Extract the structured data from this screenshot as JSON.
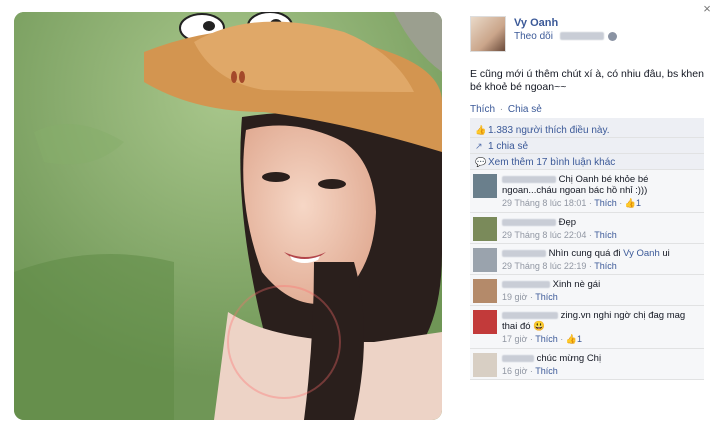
{
  "post": {
    "author_name": "Vy Oanh",
    "follow_label": "Theo dõi",
    "caption": "E cũng mới ú thêm chút xí à, có nhiu đâu, bs khen bé khoẻ bé ngoan~~",
    "actions": {
      "like": "Thích",
      "sep": "·",
      "share": "Chia sẻ"
    }
  },
  "stats": {
    "likes": "1.383 người thích điều này.",
    "shares": "1 chia sẻ",
    "more_comments": "Xem thêm 17 bình luận khác"
  },
  "comments": [
    {
      "text": "Chị Oanh bé khỏe bé ngoan...cháu ngoan bác hồ nhỉ :)))",
      "time": "29 Tháng 8 lúc 18:01",
      "like": "Thích",
      "count": "1",
      "avatar_color": "#6a7f8c"
    },
    {
      "text": "Đẹp",
      "time": "29 Tháng 8 lúc 22:04",
      "like": "Thích",
      "count": "",
      "avatar_color": "#7a8a5a"
    },
    {
      "text": "Nhìn cung quá đi",
      "mention": "Vy Oanh",
      "suffix": "ui",
      "time": "29 Tháng 8 lúc 22:19",
      "like": "Thích",
      "count": "",
      "avatar_color": "#9aa3ad"
    },
    {
      "text": "Xinh nè gái",
      "time": "19 giờ",
      "like": "Thích",
      "count": "",
      "avatar_color": "#b48a6a"
    },
    {
      "text": "zing.vn nghi ngờ chị đag mag thai đó 😃",
      "time": "17 giờ",
      "like": "Thích",
      "count": "1",
      "avatar_color": "#c23a3a"
    },
    {
      "text": "chúc mừng Chị",
      "time": "16 giờ",
      "like": "Thích",
      "count": "",
      "avatar_color": "#d8cfc4"
    }
  ],
  "close_label": "×"
}
